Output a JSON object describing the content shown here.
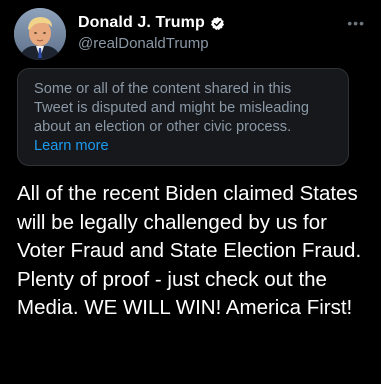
{
  "author": {
    "display_name": "Donald J. Trump",
    "handle": "@realDonaldTrump",
    "verified": true,
    "avatar_icon": "profile-photo"
  },
  "menu": {
    "more_label": "•••"
  },
  "notice": {
    "text": "Some or all of the content shared in this Tweet is disputed and might be misleading about an election or other civic process.",
    "link_label": "Learn more"
  },
  "tweet": {
    "text": "All of the recent Biden claimed States will be legally challenged by us for Voter Fraud and State Election Fraud. Plenty of proof - just check out the Media. WE WILL WIN! America First!"
  },
  "colors": {
    "background": "#000000",
    "secondary_text": "#8b98a5",
    "link": "#1d9bf0",
    "notice_background": "#16181c",
    "verified_badge": "#ffffff"
  }
}
